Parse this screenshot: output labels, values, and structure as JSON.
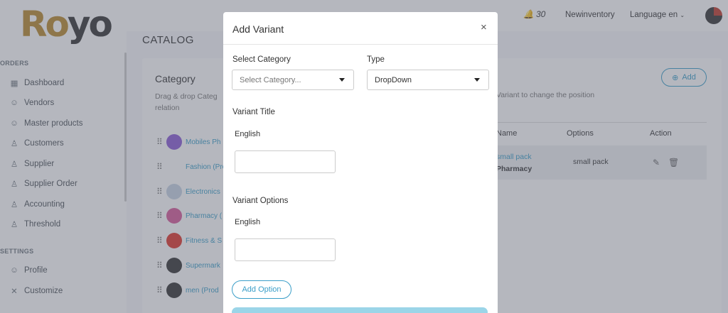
{
  "sidebar": {
    "logo": "Royo",
    "section_orders": "ORDERS",
    "section_settings": "SETTINGS",
    "items": [
      {
        "label": "Dashboard",
        "icon": "dashboard-icon"
      },
      {
        "label": "Vendors",
        "icon": "vendor-icon"
      },
      {
        "label": "Master products",
        "icon": "products-icon"
      },
      {
        "label": "Customers",
        "icon": "customers-icon"
      },
      {
        "label": "Supplier",
        "icon": "supplier-icon"
      },
      {
        "label": "Supplier Order",
        "icon": "supplier-order-icon"
      },
      {
        "label": "Accounting",
        "icon": "accounting-icon"
      },
      {
        "label": "Threshold",
        "icon": "threshold-icon"
      }
    ],
    "settings_items": [
      {
        "label": "Profile",
        "icon": "profile-icon"
      },
      {
        "label": "Customize",
        "icon": "customize-icon"
      }
    ]
  },
  "topbar": {
    "notification_count": "30",
    "store_name": "Newinventory",
    "language": "Language en"
  },
  "page": {
    "title": "CATALOG"
  },
  "category": {
    "title": "Category",
    "desc_line1": "Drag & drop Categ",
    "desc_line2": "relation",
    "rows": [
      "Mobiles Ph",
      "Fashion (Pro",
      "Electronics",
      "Pharmacy (",
      "Fitness & S",
      "Supermark",
      "men (Prod"
    ]
  },
  "variant_panel": {
    "desc": "Variant to change the position",
    "add_label": "Add",
    "columns": [
      "Name",
      "Options",
      "Action"
    ],
    "row": {
      "name": "small pack",
      "category": "Pharmacy",
      "options": "small pack"
    }
  },
  "modal": {
    "title": "Add Variant",
    "close": "×",
    "select_category_label": "Select Category",
    "select_category_value": "Select Category...",
    "type_label": "Type",
    "type_value": "DropDown",
    "variant_title_label": "Variant Title",
    "english_label_1": "English",
    "variant_options_label": "Variant Options",
    "english_label_2": "English",
    "add_option_label": "Add Option"
  }
}
